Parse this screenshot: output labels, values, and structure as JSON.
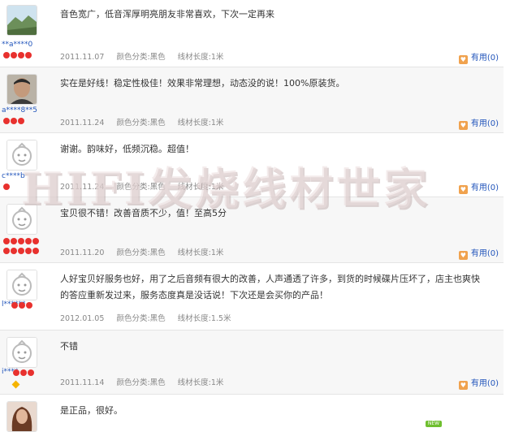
{
  "reviews": [
    {
      "content": "音色宽广，低音浑厚明亮朋友非常喜欢，下次一定再来",
      "date": "2011.11.07",
      "color": "颜色分类:黑色",
      "length": "线材长度:1米",
      "useful": "有用(0)",
      "user": "**a****0",
      "avatar": "landscape"
    },
    {
      "content": "实在是好线！稳定性极佳！效果非常理想，动态没的说！100%原装货。",
      "date": "2011.11.24",
      "color": "颜色分类:黑色",
      "length": "线材长度:1米",
      "useful": "有用(0)",
      "user": "a****8**5",
      "avatar": "person"
    },
    {
      "content": "谢谢。韵味好，低频沉稳。超值！",
      "date": "2011.11.24",
      "color": "颜色分类:黑色",
      "length": "线材长度:1米",
      "useful": "有用(0)",
      "user": "c****b",
      "avatar": "default"
    },
    {
      "content": "宝贝很不错！改善音质不少，值！至高5分",
      "date": "2011.11.20",
      "color": "颜色分类:黑色",
      "length": "线材长度:1米",
      "useful": "有用(0)",
      "user": "",
      "avatar": "default"
    },
    {
      "content": "人好宝贝好服务也好，用了之后音频有很大的改善，人声通透了许多，到货的时候碟片压坏了，店主也爽快的答应重新发过来，服务态度真是没话说！下次还是会买你的产品！",
      "date": "2012.01.05",
      "color": "颜色分类:黑色",
      "length": "线材长度:1.5米",
      "useful": "",
      "user": "l******",
      "avatar": "default"
    },
    {
      "content": "不错",
      "date": "2011.11.14",
      "color": "颜色分类:黑色",
      "length": "线材长度:1米",
      "useful": "有用(0)",
      "user": "i****",
      "avatar": "default"
    },
    {
      "content": "是正品，很好。",
      "date": "",
      "color": "",
      "length": "",
      "useful": "",
      "user": "",
      "avatar": "woman"
    }
  ],
  "watermark": "HIFI发烧线材世家",
  "badge": "NEW",
  "colors": {
    "link": "#2255bb",
    "star": "#e8312e",
    "useful_icon": "#f0a24e"
  }
}
